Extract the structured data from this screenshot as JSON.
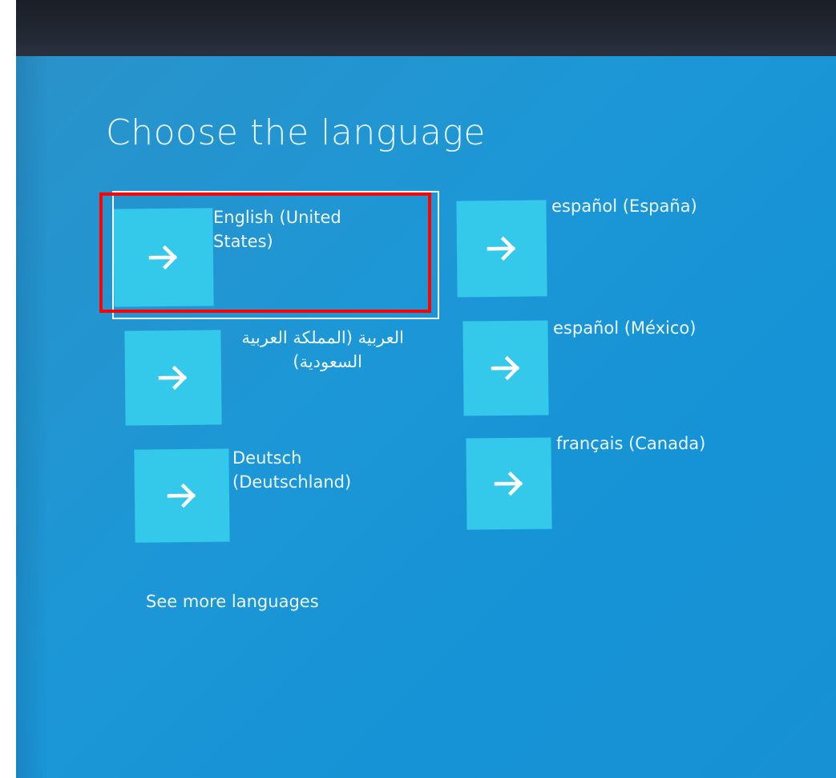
{
  "screen": {
    "title": "Choose the language",
    "background_color": "#1d97d6",
    "tile_color": "#34c8ea",
    "annotation_color": "#ff0000"
  },
  "languages": {
    "left": [
      {
        "label_line1": "English (United",
        "label_line2": "States)",
        "icon": "arrow-right-icon",
        "focused": true
      },
      {
        "label_line1": "العربية (المملكة العربية",
        "label_line2": "السعودية)",
        "icon": "arrow-right-icon"
      },
      {
        "label_line1": "Deutsch",
        "label_line2": "(Deutschland)",
        "icon": "arrow-right-icon"
      }
    ],
    "right": [
      {
        "label_line1": "español (España)",
        "icon": "arrow-right-icon"
      },
      {
        "label_line1": "español (México)",
        "icon": "arrow-right-icon"
      },
      {
        "label_line1": "français (Canada)",
        "icon": "arrow-right-icon"
      }
    ]
  },
  "see_more_link": "See more languages"
}
